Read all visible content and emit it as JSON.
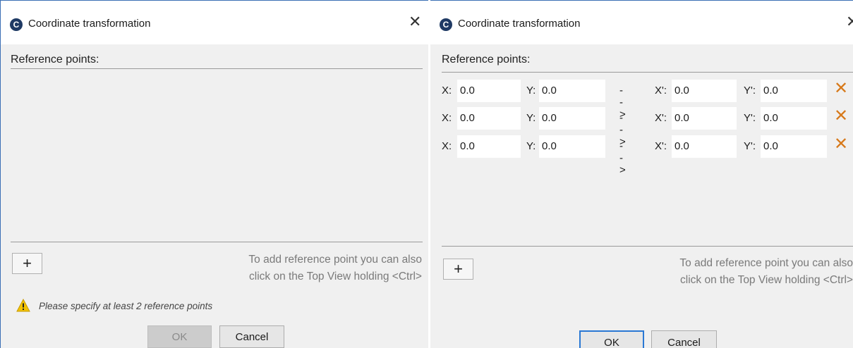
{
  "dialog_empty": {
    "title": "Coordinate transformation",
    "icon_letter": "C",
    "section_label": "Reference points:",
    "add_label": "+",
    "hint_line1": "To add reference point you can also",
    "hint_line2": "click on the Top View holding <Ctrl>",
    "warning": "Please specify at least 2 reference points",
    "ok_label": "OK",
    "cancel_label": "Cancel",
    "close_glyph": "✕"
  },
  "dialog_filled": {
    "title": "Coordinate transformation",
    "icon_letter": "C",
    "section_label": "Reference points:",
    "columns": {
      "x": "X:",
      "y": "Y:",
      "arrow": "-->",
      "xp": "X':",
      "yp": "Y':"
    },
    "rows": [
      {
        "x": "0.0",
        "y": "0.0",
        "xp": "0.0",
        "yp": "0.0"
      },
      {
        "x": "0.0",
        "y": "0.0",
        "xp": "0.0",
        "yp": "0.0"
      },
      {
        "x": "0.0",
        "y": "0.0",
        "xp": "0.0",
        "yp": "0.0"
      }
    ],
    "remove_glyph": "✕",
    "add_label": "+",
    "hint_line1": "To add reference point you can also",
    "hint_line2": "click on the Top View holding <Ctrl>",
    "ok_label": "OK",
    "cancel_label": "Cancel",
    "close_glyph": "✕"
  },
  "colors": {
    "accent": "#2a78d4",
    "remove": "#d7791a",
    "warning": "#f2c200"
  }
}
